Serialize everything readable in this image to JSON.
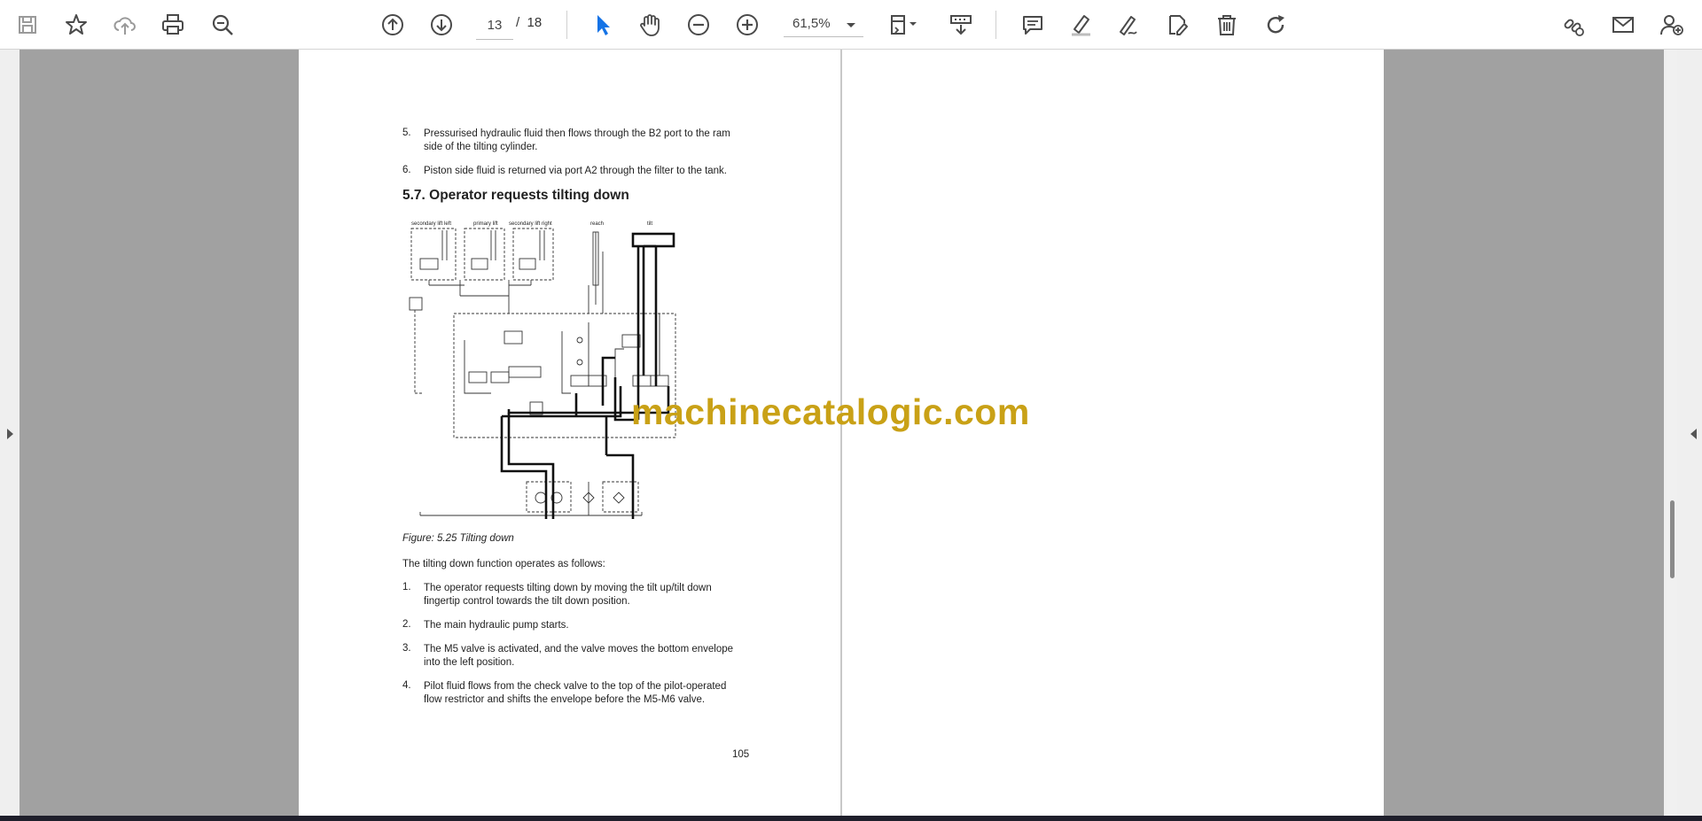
{
  "toolbar": {
    "icons": [
      "save-icon",
      "star-icon",
      "cloud-upload-icon",
      "print-icon",
      "zoom-search-icon",
      "page-up-icon",
      "page-down-icon",
      "select-cursor-icon",
      "hand-icon",
      "zoom-out-icon",
      "zoom-in-icon",
      "fit-page-icon",
      "scroll-mode-icon",
      "comment-icon",
      "highlight-icon",
      "draw-icon",
      "fill-sign-icon",
      "delete-icon",
      "rotate-icon",
      "share-link-icon",
      "email-icon",
      "add-user-icon"
    ],
    "current_page": "13",
    "page_separator": "/",
    "total_pages": "18",
    "zoom": "61,5%"
  },
  "document": {
    "item5_num": "5.",
    "item5_line1": "Pressurised hydraulic fluid then flows through the B2 port to the ram",
    "item5_line2": "side of the tilting cylinder.",
    "item6_num": "6.",
    "item6_line1": "Piston side fluid is returned via port A2 through the filter to the tank.",
    "heading": "5.7. Operator requests tilting down",
    "diagram_labels": [
      "secondary lift left",
      "primary lift",
      "secondary lift right",
      "reach",
      "tilt"
    ],
    "caption": "Figure: 5.25 Tilting down",
    "intro": "The tilting down function operates as follows:",
    "steps": [
      {
        "num": "1.",
        "line1": "The operator requests tilting down by moving the tilt up/tilt down",
        "line2": "fingertip control towards the tilt down position."
      },
      {
        "num": "2.",
        "line1": "The main hydraulic pump starts.",
        "line2": ""
      },
      {
        "num": "3.",
        "line1": "The M5 valve is activated, and the valve moves the bottom envelope",
        "line2": "into the left position."
      },
      {
        "num": "4.",
        "line1": "Pilot fluid flows from the check valve to the top of the pilot-operated",
        "line2": "flow restrictor and shifts the envelope before the M5-M6 valve."
      }
    ],
    "page_number": "105"
  },
  "watermark": "machinecatalogic.com",
  "colors": {
    "watermark": "#c9a116",
    "viewer_bg": "#a1a1a1",
    "toolbar_bg": "#ffffff",
    "select_active": "#1473e6"
  }
}
